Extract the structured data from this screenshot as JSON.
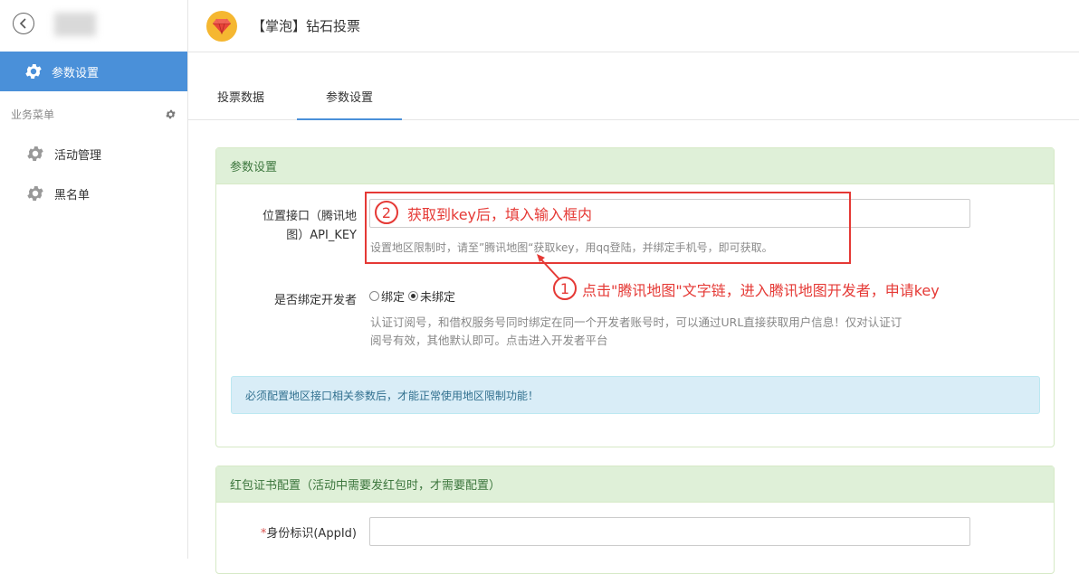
{
  "sidebar": {
    "active_item": "参数设置",
    "group_label": "业务菜单",
    "items": [
      "活动管理",
      "黑名单"
    ]
  },
  "header": {
    "title": "【掌泡】钻石投票"
  },
  "tabs": [
    "投票数据",
    "参数设置"
  ],
  "panel1": {
    "title": "参数设置",
    "api_key_label_line1": "位置接口（腾讯地",
    "api_key_label_line2": "图）API_KEY",
    "api_key_help": "设置地区限制时，请至”腾讯地图“获取key，用qq登陆，并绑定手机号，即可获取。",
    "bind_label": "是否绑定开发者",
    "bind_options": [
      "绑定",
      "未绑定"
    ],
    "bind_help_line1": "认证订阅号，和借权服务号同时绑定在同一个开发者账号时，可以通过URL直接获取用户信息！仅对认证订",
    "bind_help_line2": "阅号有效，其他默认即可。点击进入开发者平台",
    "info": "必须配置地区接口相关参数后，才能正常使用地区限制功能！"
  },
  "panel2": {
    "title": "红包证书配置（活动中需要发红包时，才需要配置）",
    "appid_required": "*",
    "appid_label": "身份标识(AppId)"
  },
  "annotations": {
    "step1_num": "1",
    "step1_text": "点击\"腾讯地图\"文字链，进入腾讯地图开发者，申请key",
    "step2_num": "2",
    "step2_text": "获取到key后，填入输入框内"
  },
  "colors": {
    "sidebar_active": "#4a90d9",
    "panel_header": "#dff0d8",
    "info_bg": "#d9edf7",
    "annotation": "#e53935"
  },
  "icons": {
    "back": "chevron-left-circle-icon",
    "gear": "gear-icon",
    "logo": "diamond-icon"
  }
}
